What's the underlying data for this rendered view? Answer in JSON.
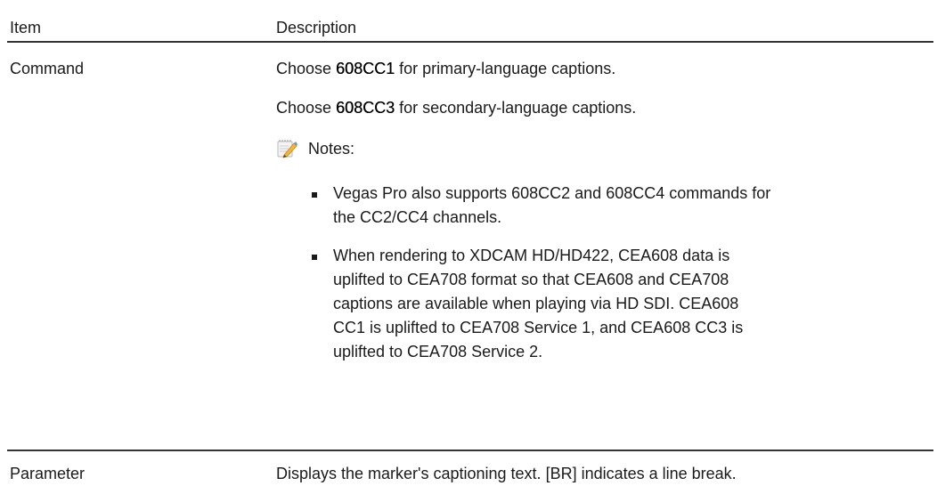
{
  "table": {
    "header": {
      "item": "Item",
      "description": "Description"
    },
    "rows": [
      {
        "item": "Command",
        "para1": {
          "before": "Choose ",
          "bold": "608CC1",
          "after": " for primary-language captions."
        },
        "para2": {
          "before": "Choose ",
          "bold": "608CC3",
          "after": " for secondary-language captions."
        },
        "notes_label": "Notes:",
        "notes_icon": "notepad-pencil-icon",
        "notes": [
          "Vegas Pro also supports 608CC2 and 608CC4 commands for the CC2/CC4 channels.",
          "When rendering to XDCAM HD/HD422, CEA608 data is uplifted to CEA708 format so that CEA608 and CEA708 captions are available when playing via HD SDI. CEA608 CC1 is uplifted to CEA708 Service 1, and CEA608 CC3 is uplifted to CEA708 Service 2."
        ]
      },
      {
        "item": "Parameter",
        "description": "Displays the marker's captioning text. [BR] indicates a line break."
      }
    ]
  }
}
